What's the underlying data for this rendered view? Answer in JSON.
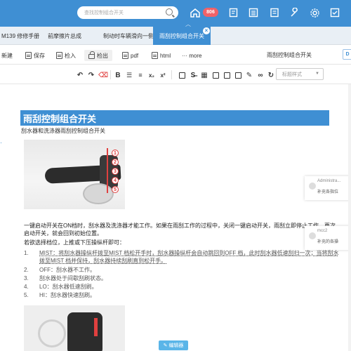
{
  "header": {
    "search_placeholder": "查找控制组合开关",
    "badge_count": "806",
    "icons": [
      "home-icon",
      "notifications-badge",
      "edit-doc-icon",
      "list-icon",
      "wrench-icon",
      "settings-icon",
      "checklist-icon"
    ]
  },
  "tabs": [
    {
      "label": "M139 修修手册"
    },
    {
      "label": "前摩擦片总成"
    },
    {
      "label": "制动时车辆滑向一侧"
    },
    {
      "label": "雨刮控制组合开关",
      "active": true
    }
  ],
  "toolbar": {
    "new": "新建",
    "save": "保存",
    "checkin": "检入",
    "checkout": "检出",
    "pdf": "pdf",
    "html": "html",
    "more": "··· more",
    "doc_title": "雨刮控制组合开关",
    "right_button": "D",
    "style_select": "标题样式"
  },
  "document": {
    "heading": "雨刮控制组合开关",
    "subtitle": "刮水器和洗涤器雨刮控制组合开关",
    "figure1_numbers": [
      "1",
      "2",
      "3",
      "4",
      "5"
    ],
    "para1_line1": "一键启动开关在ON档时，刮水器及洗涤器才能工作。如果在雨刮工作的过程中，关闭一键启动开关，雨刮立即停止工作，再次",
    "para1_line2": "启动开关，就会回到初始位置。",
    "para2": "若欲选择档位，上推或下压操纵杆即可：",
    "list": [
      {
        "idx": "1.",
        "text": "MIST：将刮水器操纵杆拨至MIST 档松开手时，刮水器操纵杆会自动跳回到OFF 档，此时刮水器低速刮扫一次；当将刮水",
        "cont": "拨至MIST 档并保持，刮水器持续刮刷直到松开手。"
      },
      {
        "idx": "2.",
        "text": "OFF：刮水器不工作。"
      },
      {
        "idx": "3.",
        "text": "刮水器处于间歇刮刷状态。"
      },
      {
        "idx": "4.",
        "text": "LO：刮水器低速刮刷。"
      },
      {
        "idx": "5.",
        "text": "HI：刮水器快速刮刷。"
      }
    ],
    "editor_button": "编辑器"
  },
  "comments": [
    {
      "name": "Administra...",
      "text": "补充各指位"
    },
    {
      "name": "mcc2",
      "text": "补充的各操"
    }
  ]
}
